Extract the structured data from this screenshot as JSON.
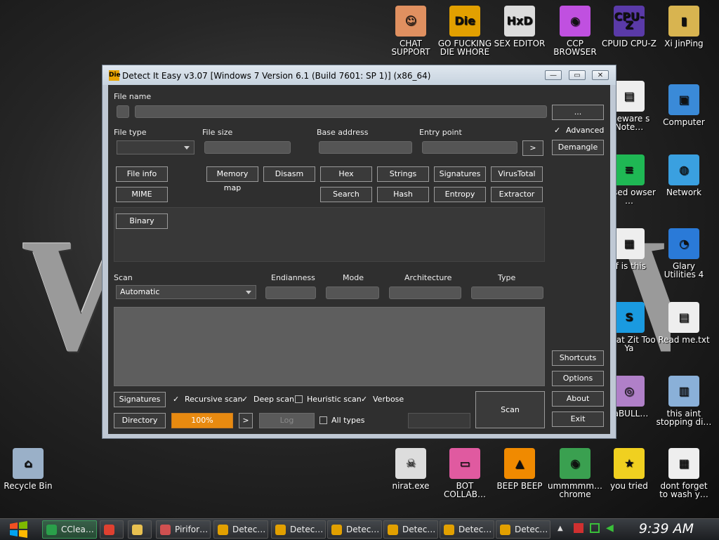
{
  "desktop": {
    "icons": [
      {
        "id": "chat",
        "label": "CHAT SUPPORT",
        "glyph": "☺",
        "color": "#e09060"
      },
      {
        "id": "die",
        "label": "GO FUCKING DIE WHORE",
        "glyph": "Die",
        "color": "#e2a000"
      },
      {
        "id": "hxd",
        "label": "SEX EDITOR",
        "glyph": "HxD",
        "color": "#dcdcdc"
      },
      {
        "id": "ccp",
        "label": "CCP BROWSER",
        "glyph": "◉",
        "color": "#c050e0"
      },
      {
        "id": "cpuz",
        "label": "CPUID CPU-Z",
        "glyph": "CPU-Z",
        "color": "#5a3aa8"
      },
      {
        "id": "xi",
        "label": "Xi JinPing",
        "glyph": "▮",
        "color": "#d8b450"
      },
      {
        "id": "freeware",
        "label": "reeware s Note…",
        "glyph": "▤",
        "color": "#eeeeee"
      },
      {
        "id": "computer",
        "label": "Computer",
        "glyph": "▣",
        "color": "#3a8ad8"
      },
      {
        "id": "based",
        "label": "based owser …",
        "glyph": "≡",
        "color": "#1fb854"
      },
      {
        "id": "network",
        "label": "Network",
        "glyph": "◍",
        "color": "#3aa0e0"
      },
      {
        "id": "tf",
        "label": "tf is this",
        "glyph": "▦",
        "color": "#eeeeee"
      },
      {
        "id": "glary",
        "label": "Glary Utilities 4",
        "glyph": "◔",
        "color": "#2a7ad8"
      },
      {
        "id": "skype",
        "label": "What Zit Too Ya",
        "glyph": "S",
        "color": "#1a9ae0"
      },
      {
        "id": "readme",
        "label": "Read me.txt",
        "glyph": "▤",
        "color": "#eeeeee"
      },
      {
        "id": "rabull",
        "label": "raBULL…",
        "glyph": "◎",
        "color": "#b080c8"
      },
      {
        "id": "aint",
        "label": "this aint stopping di…",
        "glyph": "▥",
        "color": "#8ab0d8"
      },
      {
        "id": "recycle",
        "label": "Recycle Bin",
        "glyph": "⌂",
        "color": "#9ab0c8"
      },
      {
        "id": "nirat",
        "label": "nirat.exe",
        "glyph": "☠",
        "color": "#dddddd"
      },
      {
        "id": "bot",
        "label": "BOT COLLAB…",
        "glyph": "▭",
        "color": "#e05aa0"
      },
      {
        "id": "beep",
        "label": "BEEP BEEP",
        "glyph": "▲",
        "color": "#f08a00"
      },
      {
        "id": "chrome",
        "label": "ummmmm… chrome",
        "glyph": "◉",
        "color": "#3aa050"
      },
      {
        "id": "star",
        "label": "you tried",
        "glyph": "★",
        "color": "#f0d020"
      },
      {
        "id": "forget",
        "label": "dont forget to wash y…",
        "glyph": "▦",
        "color": "#eeeeee"
      }
    ]
  },
  "window": {
    "title": "Detect It Easy v3.07 [Windows 7 Version 6.1 (Build 7601: SP 1)] (x86_64)",
    "logo": "Die",
    "labels": {
      "file_name": "File name",
      "file_type": "File type",
      "file_size": "File size",
      "base_address": "Base address",
      "entry_point": "Entry point",
      "scan": "Scan",
      "endianness": "Endianness",
      "mode": "Mode",
      "architecture": "Architecture",
      "type": "Type"
    },
    "buttons": {
      "browse": "...",
      "entry_go": ">",
      "demangle": "Demangle",
      "file_info": "File info",
      "mime": "MIME",
      "memory_map": "Memory map",
      "disasm": "Disasm",
      "hex": "Hex",
      "strings": "Strings",
      "signatures_top": "Signatures",
      "virustotal": "VirusTotal",
      "search": "Search",
      "hash": "Hash",
      "entropy": "Entropy",
      "extractor": "Extractor",
      "binary": "Binary",
      "shortcuts": "Shortcuts",
      "options": "Options",
      "about": "About",
      "exit": "Exit",
      "signatures_bottom": "Signatures",
      "directory": "Directory",
      "progress_go": ">",
      "log": "Log",
      "scan": "Scan"
    },
    "advanced": "Advanced",
    "scan_mode": "Automatic",
    "progress": {
      "label": "100%",
      "percent": 100,
      "color": "#e88a10"
    },
    "checks": {
      "recursive": {
        "label": "Recursive scan",
        "checked": true
      },
      "deep": {
        "label": "Deep scan",
        "checked": true
      },
      "heuristic": {
        "label": "Heuristic scan",
        "checked": false
      },
      "verbose": {
        "label": "Verbose",
        "checked": true
      },
      "all_types": {
        "label": "All types",
        "checked": false
      }
    }
  },
  "taskbar": {
    "items": [
      {
        "label": "CClea…",
        "icon": "ccleaner-icon",
        "color": "#2aa04a",
        "active": true
      },
      {
        "label": "",
        "icon": "chrome-icon",
        "color": "#e04030"
      },
      {
        "label": "",
        "icon": "folder-icon",
        "color": "#e8c050"
      },
      {
        "label": "Pirifor…",
        "icon": "piriform-icon",
        "color": "#d05050"
      },
      {
        "label": "Detec…",
        "icon": "die-icon",
        "color": "#e2a000"
      },
      {
        "label": "Detec…",
        "icon": "die-icon",
        "color": "#e2a000"
      },
      {
        "label": "Detec…",
        "icon": "die-icon",
        "color": "#e2a000"
      },
      {
        "label": "Detec…",
        "icon": "die-icon",
        "color": "#e2a000"
      },
      {
        "label": "Detec…",
        "icon": "die-icon",
        "color": "#e2a000"
      },
      {
        "label": "Detec…",
        "icon": "die-icon",
        "color": "#e2a000"
      }
    ],
    "clock": "9:39 AM"
  }
}
